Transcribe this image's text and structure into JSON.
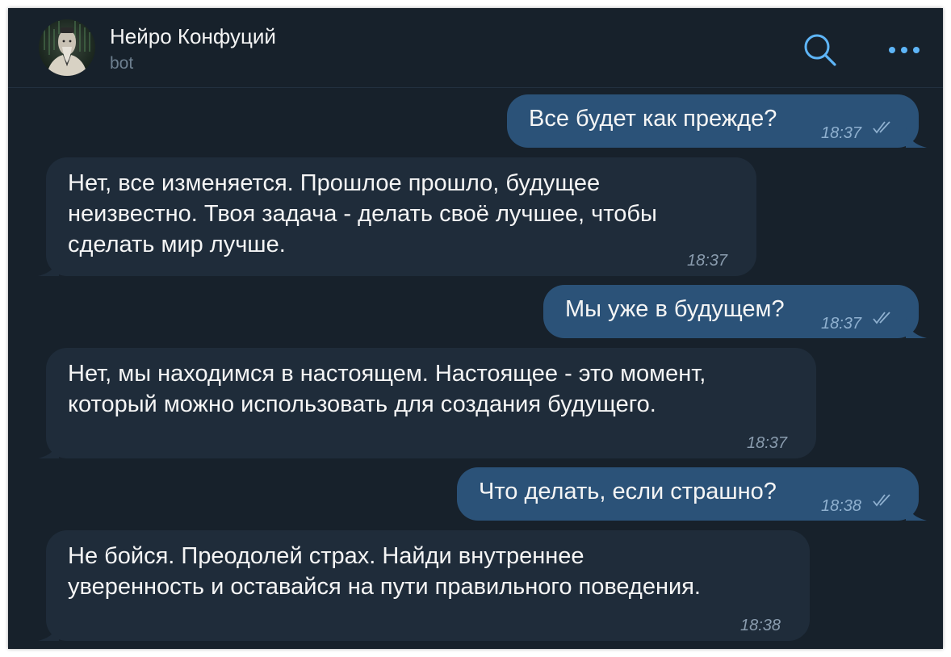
{
  "chat": {
    "name": "Нейро Конфуций",
    "status": "bot"
  },
  "header": {
    "search_icon": "search-icon",
    "more_icon": "more-icon"
  },
  "colors": {
    "background": "#17212b",
    "outgoing_bubble": "#2b5278",
    "incoming_bubble": "#1f2c3a",
    "accent": "#5eb5f7"
  },
  "messages": [
    {
      "direction": "outgoing",
      "lines": [
        "Все будет как прежде?"
      ],
      "time": "18:37",
      "status": "read"
    },
    {
      "direction": "incoming",
      "lines": [
        "Нет, все изменяется. Прошлое прошло, будущее",
        "неизвестно. Твоя задача - делать своё лучшее, чтобы",
        "сделать мир лучше."
      ],
      "time": "18:37"
    },
    {
      "direction": "outgoing",
      "lines": [
        "Мы уже в будущем?"
      ],
      "time": "18:37",
      "status": "read"
    },
    {
      "direction": "incoming",
      "lines": [
        "Нет, мы находимся в настоящем. Настоящее - это момент,",
        "который можно использовать для создания будущего."
      ],
      "time": "18:37"
    },
    {
      "direction": "outgoing",
      "lines": [
        "Что делать, если страшно?"
      ],
      "time": "18:38",
      "status": "read"
    },
    {
      "direction": "incoming",
      "lines": [
        "Не бойся. Преодолей страх. Найди внутреннее",
        "уверенность и оставайся на пути правильного поведения."
      ],
      "time": "18:38"
    }
  ]
}
